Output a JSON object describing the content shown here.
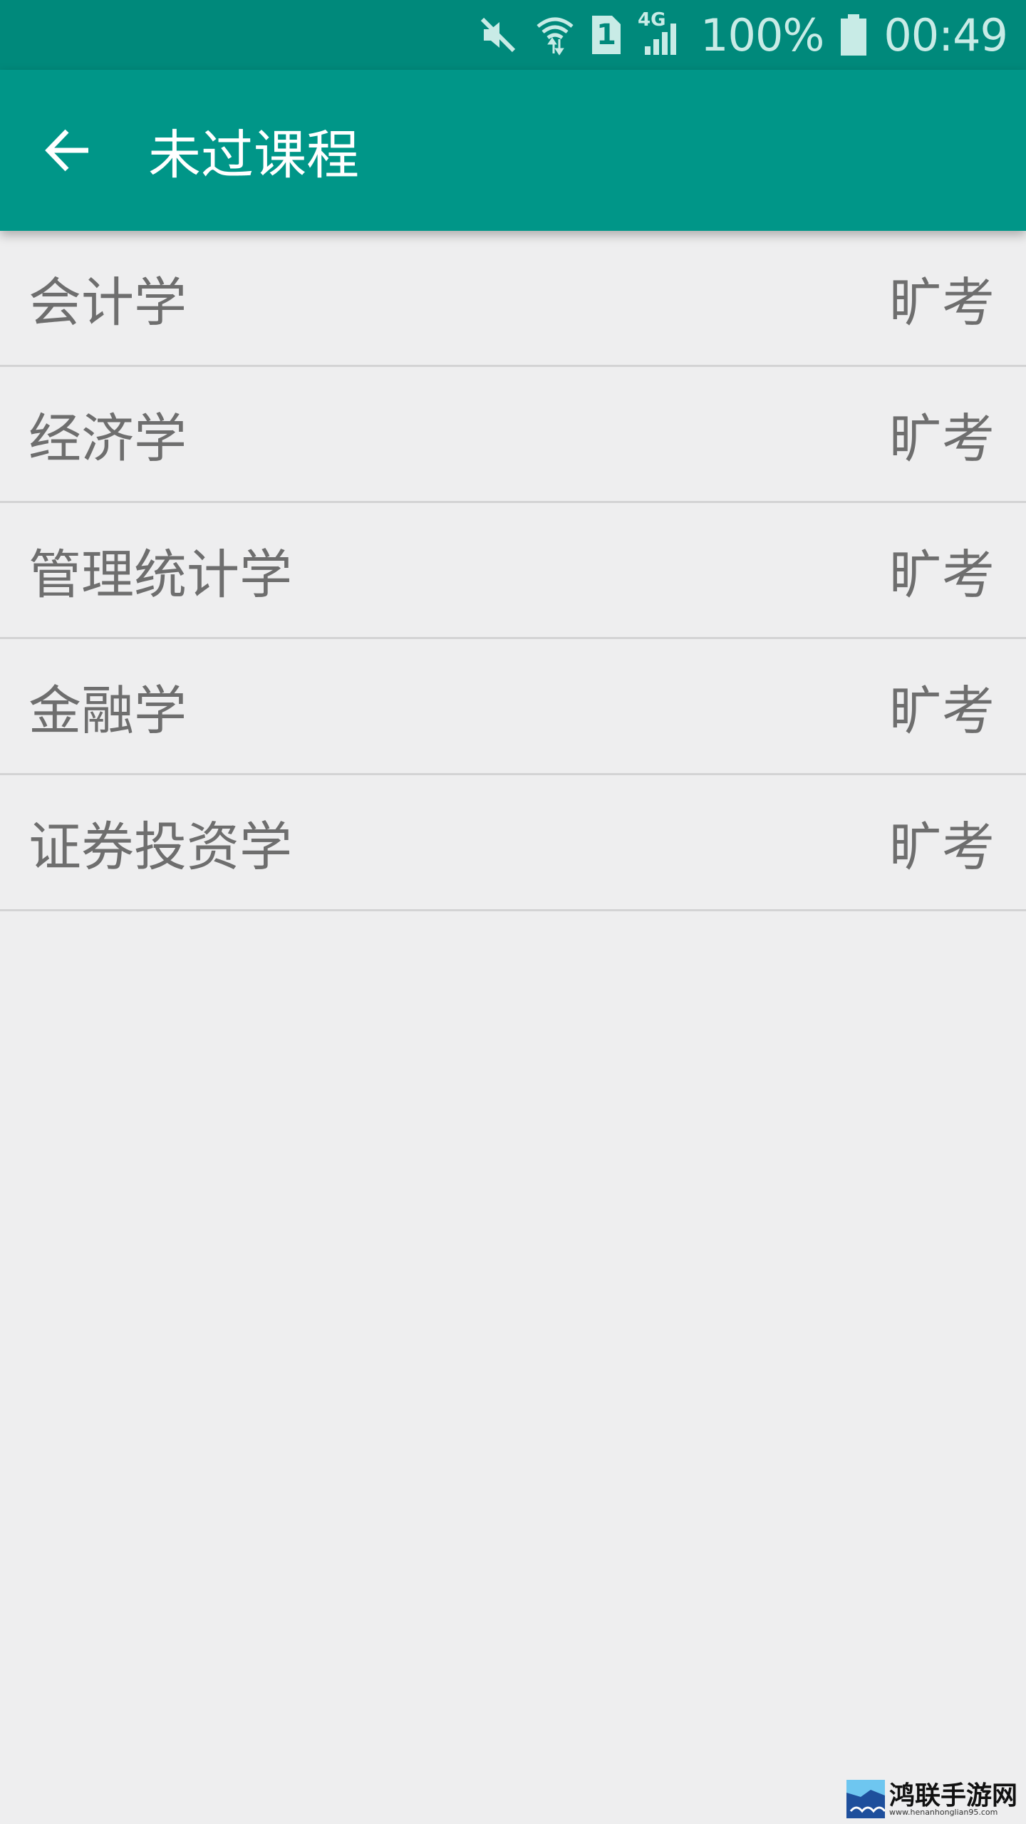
{
  "status_bar": {
    "battery_text": "100%",
    "time": "00:49",
    "network_label": "4G",
    "sim_label": "1",
    "icons": [
      "mute-icon",
      "wifi-icon",
      "sim-icon",
      "signal-icon",
      "battery-icon"
    ]
  },
  "app_bar": {
    "title": "未过课程",
    "back_icon": "arrow-back-icon",
    "color": "#009688"
  },
  "courses": [
    {
      "name": "会计学",
      "status": "旷考"
    },
    {
      "name": "经济学",
      "status": "旷考"
    },
    {
      "name": "管理统计学",
      "status": "旷考"
    },
    {
      "name": "金融学",
      "status": "旷考"
    },
    {
      "name": "证券投资学",
      "status": "旷考"
    }
  ],
  "watermark": {
    "name": "鸿联手游网",
    "url": "www.henanhonglian95.com"
  }
}
